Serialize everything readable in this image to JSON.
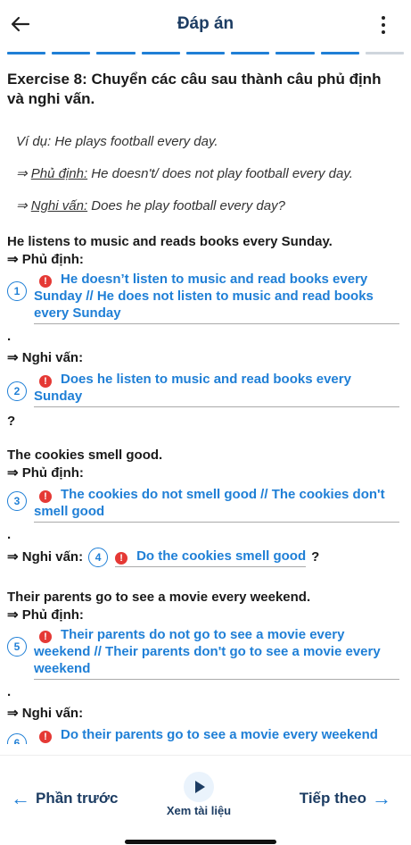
{
  "header": {
    "title": "Đáp án",
    "back_icon": "arrow-left-icon",
    "menu_icon": "more-vertical-icon"
  },
  "progress": {
    "segments_total": 9,
    "segments_done": 8
  },
  "exercise": {
    "title": "Exercise 8: Chuyển các câu sau thành câu phủ định và nghi vấn.",
    "example": {
      "line1": "Ví dụ: He plays football every day.",
      "neg_label": "Phủ định:",
      "neg_text": " He doesn't/ does not play football every day.",
      "q_label": "Nghi vấn:",
      "q_text": " Does he play football every day?"
    },
    "arrow": "⇒",
    "neg_label": "Phủ định:",
    "q_label": "Nghi vấn:",
    "items": [
      {
        "sentence": "He listens to music and reads books every Sunday.",
        "neg": {
          "num": "1",
          "answer": "He doesn’t listen to music and read books every Sunday // He does not listen to music and read books every Sunday",
          "trail": "."
        },
        "q": {
          "num": "2",
          "answer": "Does he listen to music and read books every Sunday",
          "trail": "?"
        }
      },
      {
        "sentence": "The cookies smell good.",
        "neg": {
          "num": "3",
          "answer": "The cookies do not smell good // The cookies don't smell good",
          "trail": "."
        },
        "q": {
          "num": "4",
          "answer": "Do the cookies smell good",
          "trail": "?"
        }
      },
      {
        "sentence": "Their parents go to see a movie every weekend.",
        "neg": {
          "num": "5",
          "answer": "Their parents do not go to see a movie every weekend // Their parents don't go to see a movie every weekend",
          "trail": "."
        },
        "q": {
          "num": "6",
          "answer": "Do their parents go to see a movie every weekend"
        }
      }
    ]
  },
  "footer": {
    "prev_label": "Phần trước",
    "next_label": "Tiếp theo",
    "material_label": "Xem tài liệu"
  },
  "colors": {
    "accent": "#1f7fd6",
    "title": "#1d3d63",
    "error": "#e53935"
  }
}
